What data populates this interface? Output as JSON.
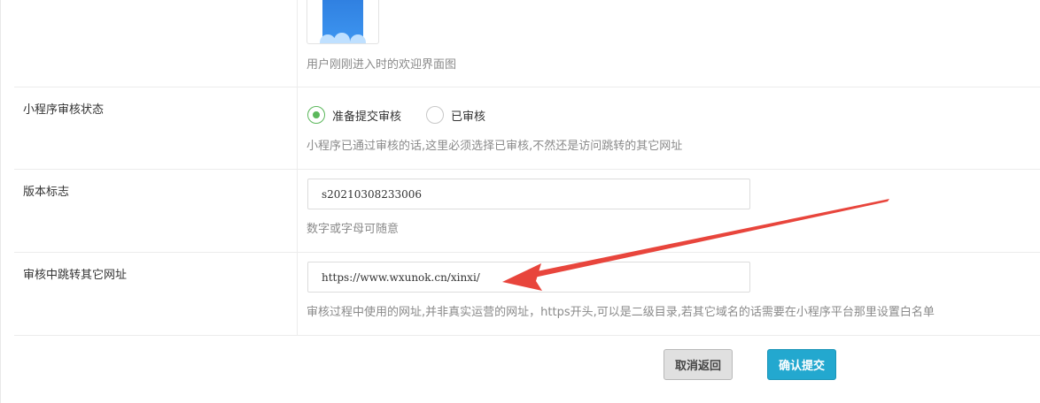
{
  "welcome": {
    "hint": "用户刚刚进入时的欢迎界面图"
  },
  "review_status": {
    "label": "小程序审核状态",
    "options": [
      {
        "label": "准备提交审核",
        "checked": true
      },
      {
        "label": "已审核",
        "checked": false
      }
    ],
    "hint": "小程序已通过审核的话,这里必须选择已审核,不然还是访问跳转的其它网址"
  },
  "version": {
    "label": "版本标志",
    "value": "s20210308233006",
    "hint": "数字或字母可随意"
  },
  "redirect": {
    "label": "审核中跳转其它网址",
    "value": "https://www.wxunok.cn/xinxi/",
    "hint": "审核过程中使用的网址,并非真实运营的网址，https开头,可以是二级目录,若其它域名的话需要在小程序平台那里设置白名单"
  },
  "buttons": {
    "cancel": "取消返回",
    "submit": "确认提交"
  },
  "colors": {
    "annotation_arrow": "#e8453c",
    "submit": "#23a8cf",
    "radio_checked": "#5cb85c"
  }
}
